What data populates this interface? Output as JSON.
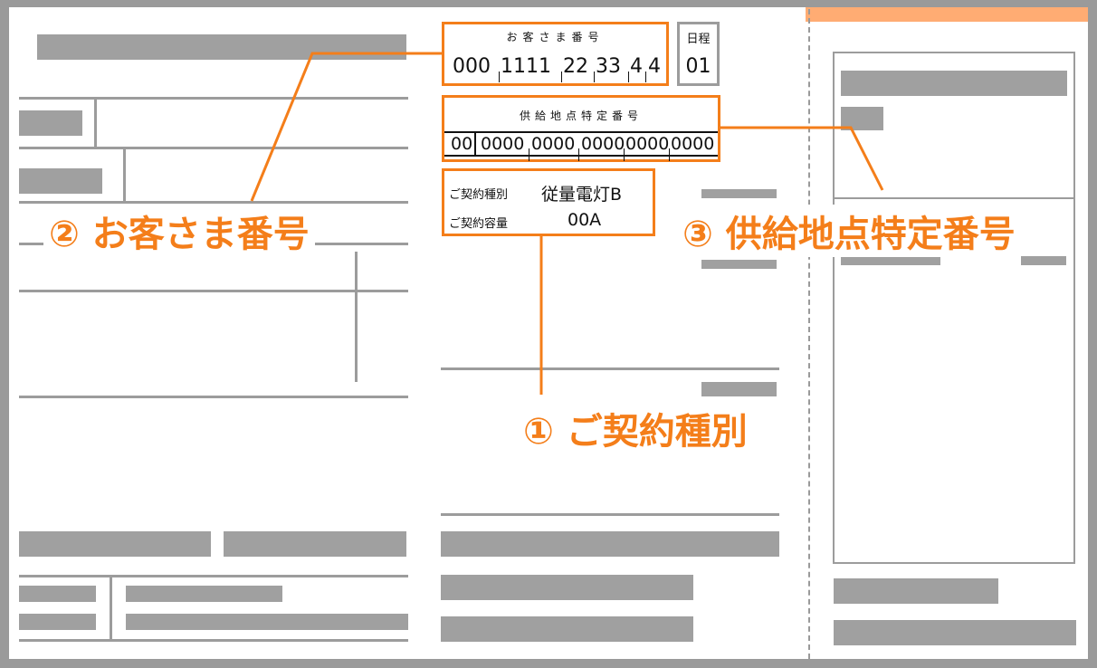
{
  "customer_number_box": {
    "heading": "お客さま番号",
    "value_segments": [
      "000",
      "1111",
      "22",
      "33",
      "4",
      "4"
    ]
  },
  "schedule_box": {
    "heading": "日程",
    "value": "01"
  },
  "supply_point_box": {
    "heading": "供給地点特定番号",
    "value_segments": [
      "00",
      "0000",
      "0000",
      "0000",
      "0000",
      "0000"
    ]
  },
  "contract_box": {
    "type_label": "ご契約種別",
    "type_value": "従量電灯B",
    "capacity_label": "ご契約容量",
    "capacity_value": "00A"
  },
  "callouts": {
    "contract_type": "① ご契約種別",
    "customer_number": "② お客さま番号",
    "supply_point": "③ 供給地点特定番号"
  },
  "colors": {
    "accent": "#f47e1a",
    "tab": "#ffac73",
    "placeholder_gray": "#a0a0a0",
    "frame_gray": "#9a9a9a"
  }
}
